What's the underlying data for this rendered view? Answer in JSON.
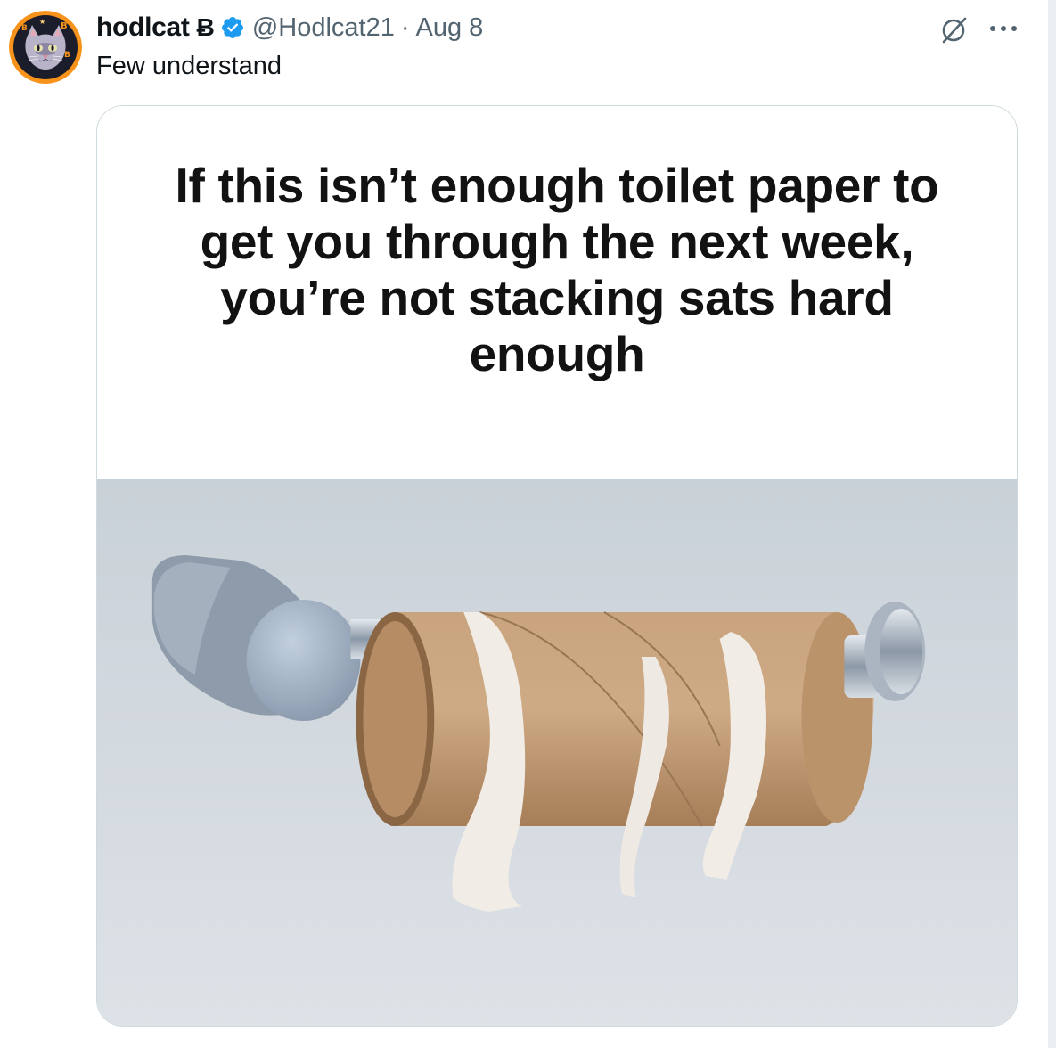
{
  "tweet": {
    "author": {
      "display_name": "hodlcat",
      "name_suffix_glyph": "Ƀ",
      "verified": true,
      "handle": "@Hodlcat21",
      "separator": "·",
      "date": "Aug 8",
      "avatar_icon": "cat-avatar-icon"
    },
    "text": "Few understand",
    "media": {
      "caption": "If this isn’t enough toilet paper to get you through the next week, you’re not stacking sats hard enough",
      "photo_icon": "empty-toilet-paper-roll-image"
    },
    "actions": {
      "grok_icon": "grok-icon",
      "more_icon": "more-options-icon"
    }
  },
  "colors": {
    "text_primary": "#0f1419",
    "text_secondary": "#536471",
    "verified_blue": "#1d9bf0",
    "border": "#cfd9de",
    "avatar_ring": "#f7931a"
  }
}
